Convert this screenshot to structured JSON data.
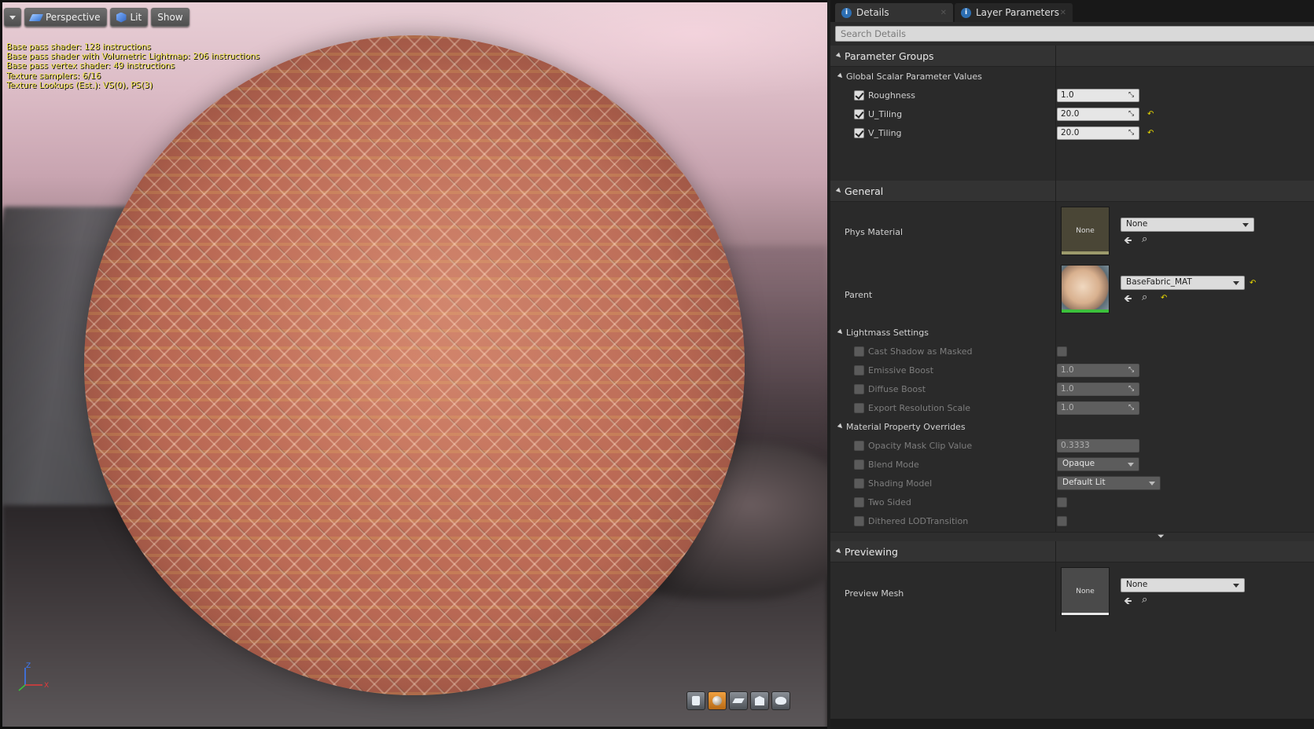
{
  "viewport": {
    "toolbar": {
      "menu_label": "",
      "perspective_label": "Perspective",
      "lit_label": "Lit",
      "show_label": "Show"
    },
    "stats": [
      "Base pass shader: 128 instructions",
      "Base pass shader with Volumetric Lightmap: 206 instructions",
      "Base pass vertex shader: 49 instructions",
      "Texture samplers: 6/16",
      "Texture Lookups (Est.): VS(0), PS(3)"
    ],
    "axis": {
      "z": "Z",
      "x": "X"
    },
    "preview_icons": [
      "cylinder-icon",
      "sphere-icon",
      "plane-icon",
      "cube-icon",
      "teapot-icon"
    ],
    "stats_color": "#f2e64e"
  },
  "panel": {
    "tabs": [
      {
        "label": "Details",
        "active": true
      },
      {
        "label": "Layer Parameters",
        "active": false
      }
    ],
    "search": {
      "placeholder": "Search Details",
      "value": ""
    },
    "parameter_groups": {
      "title": "Parameter Groups",
      "global_scalar": {
        "title": "Global Scalar Parameter Values",
        "params": [
          {
            "label": "Roughness",
            "value": "1.0",
            "checked": true,
            "modified": false
          },
          {
            "label": "U_Tiling",
            "value": "20.0",
            "checked": true,
            "modified": true
          },
          {
            "label": "V_Tiling",
            "value": "20.0",
            "checked": true,
            "modified": true
          }
        ]
      }
    },
    "general": {
      "title": "General",
      "phys_material": {
        "label": "Phys Material",
        "thumb_text": "None",
        "value": "None"
      },
      "parent": {
        "label": "Parent",
        "value": "BaseFabric_MAT"
      },
      "lightmass": {
        "title": "Lightmass Settings",
        "rows": [
          {
            "label": "Cast Shadow as Masked",
            "type": "checkbox"
          },
          {
            "label": "Emissive Boost",
            "type": "number",
            "value": "1.0"
          },
          {
            "label": "Diffuse Boost",
            "type": "number",
            "value": "1.0"
          },
          {
            "label": "Export Resolution Scale",
            "type": "number",
            "value": "1.0"
          }
        ]
      },
      "overrides": {
        "title": "Material Property Overrides",
        "rows": [
          {
            "label": "Opacity Mask Clip Value",
            "type": "text",
            "value": "0.3333"
          },
          {
            "label": "Blend Mode",
            "type": "dropdown",
            "value": "Opaque"
          },
          {
            "label": "Shading Model",
            "type": "dropdown",
            "value": "Default Lit"
          },
          {
            "label": "Two Sided",
            "type": "checkbox"
          },
          {
            "label": "Dithered LODTransition",
            "type": "checkbox"
          }
        ]
      }
    },
    "previewing": {
      "title": "Previewing",
      "preview_mesh": {
        "label": "Preview Mesh",
        "thumb_text": "None",
        "value": "None"
      }
    },
    "colors": {
      "accent_reset": "#e8d800",
      "parent_bar": "#3cc03c"
    }
  }
}
